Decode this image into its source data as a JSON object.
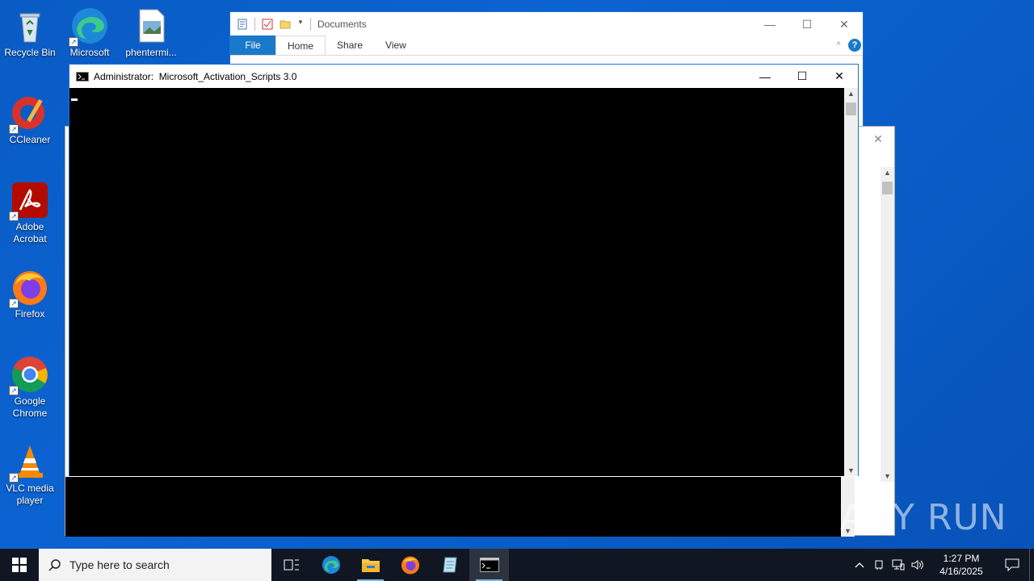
{
  "desktop": {
    "icons": [
      {
        "label": "Recycle Bin"
      },
      {
        "label": "Microsoft Edge"
      },
      {
        "label": "phentermi..."
      },
      {
        "label": "CCleaner"
      },
      {
        "label": "Adobe Acrobat"
      },
      {
        "label": "Firefox"
      },
      {
        "label": "Google Chrome"
      },
      {
        "label": "VLC media player"
      }
    ]
  },
  "explorer": {
    "title": "Documents",
    "tabs": [
      "File",
      "Home",
      "Share",
      "View"
    ]
  },
  "cmd": {
    "title": "Administrator:  Microsoft_Activation_Scripts 3.0"
  },
  "taskbar": {
    "search_placeholder": "Type here to search",
    "time": "1:27 PM",
    "date": "4/16/2025"
  },
  "watermark": {
    "text": "ANY RUN"
  },
  "colors": {
    "desktop_blue": "#0a5bc4",
    "taskbar": "#101722",
    "console_bg": "#000000",
    "ribbon_file": "#1979ca"
  }
}
